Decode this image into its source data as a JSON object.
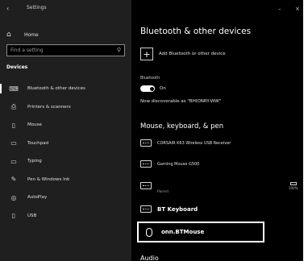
{
  "window": {
    "title": "Settings",
    "back_glyph": "‹",
    "minimize_glyph": "–",
    "close_glyph": "×"
  },
  "sidebar": {
    "home_label": "Home",
    "search_placeholder": "Find a setting",
    "section": "Devices",
    "items": [
      {
        "label": "Bluetooth & other devices",
        "icon": "bluetooth-devices-icon",
        "glyph": "⌨"
      },
      {
        "label": "Printers & scanners",
        "icon": "printer-icon",
        "glyph": "⎙"
      },
      {
        "label": "Mouse",
        "icon": "mouse-icon",
        "glyph": "▯"
      },
      {
        "label": "Touchpad",
        "icon": "touchpad-icon",
        "glyph": "▭"
      },
      {
        "label": "Typing",
        "icon": "keyboard-icon",
        "glyph": "▭"
      },
      {
        "label": "Pen & Windows Ink",
        "icon": "pen-icon",
        "glyph": "✎"
      },
      {
        "label": "AutoPlay",
        "icon": "autoplay-icon",
        "glyph": "◎"
      },
      {
        "label": "USB",
        "icon": "usb-icon",
        "glyph": "▯"
      }
    ]
  },
  "main": {
    "title": "Bluetooth & other devices",
    "add_label": "Add Bluetooth or other device",
    "bluetooth_label": "Bluetooth",
    "toggle_state": "On",
    "discoverable": "Now discoverable as \"BHIONRY-WW\"",
    "section_title": "Mouse, keyboard, & pen",
    "devices": [
      {
        "name": "CORSAIR K63 Wireless USB Receiver",
        "status": ""
      },
      {
        "name": "Gaming Mouse G500",
        "status": ""
      },
      {
        "name": "",
        "status": "Paired",
        "battery": "100%"
      },
      {
        "name": "BT Keyboard",
        "status": ""
      }
    ],
    "selected_device": "onn.BTMouse",
    "next_section": "Audio"
  },
  "colors": {
    "background": "#000000",
    "sidebar": "#1f1f1f",
    "text": "#ffffff",
    "muted": "#9a9a9a"
  }
}
